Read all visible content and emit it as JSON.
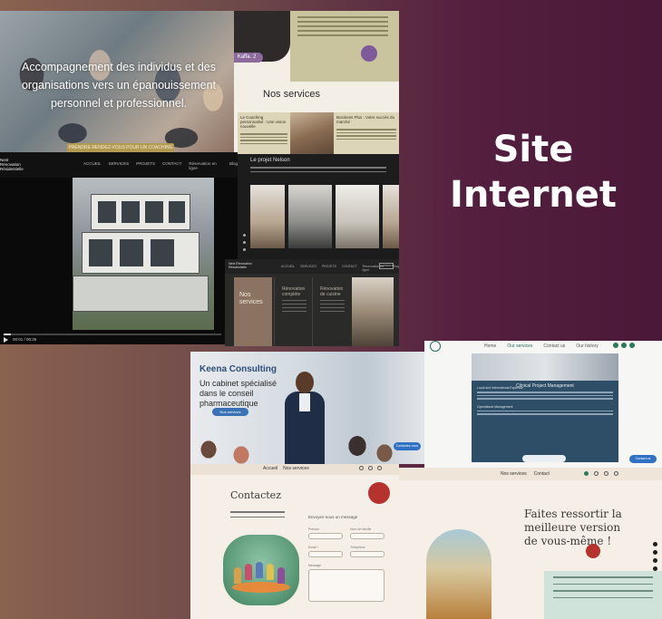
{
  "headline": "Site Internet",
  "hero": {
    "text": "Accompagnement des individus et des organisations vers un épanouissement personnel et professionnel.",
    "button": "PRENDRE RENDEZ-VOUS POUR UN COACHING GRATUIT"
  },
  "services_page": {
    "badge": "Kaffa. 2",
    "title": "Nos services",
    "card_1_title": "Le Coaching personnalisé : Une vision nouvelle",
    "card_2_title": "Business Plus : Votre succès du marché"
  },
  "architecture_site": {
    "logo": "Nest Rénovation Résidentielle",
    "menu": [
      "ACCUEIL",
      "SERVICES",
      "PROJETS",
      "CONTACT",
      "Réservation en ligne",
      "Blog"
    ],
    "time": "00:01 / 00:35"
  },
  "nelson": {
    "title": "Le projet Nelson"
  },
  "dark_services": {
    "logo": "Nest Rénovation Résidentielle",
    "menu": [
      "ACCUEIL",
      "SERVICES",
      "PROJETS",
      "CONTACT",
      "Réservation en ligne",
      "Blog"
    ],
    "nav_button": "CONTACT",
    "tile": "Nos services",
    "col_1": "Rénovation complète",
    "col_2": "Rénovation de cuisine"
  },
  "keena": {
    "brand": "Keena Consulting",
    "tagline": "Un cabinet spécialisé dans le conseil pharmaceutique",
    "cta": "Nos services",
    "chat": "Contactez-nous"
  },
  "clinical": {
    "menu": [
      "Home",
      "Our services",
      "Contact us",
      "Our history"
    ],
    "box_title": "Clinical Project Management",
    "bullet_1": "Local and International Expertise",
    "bullet_2": "Operational Management",
    "chat": "Contact us"
  },
  "contact": {
    "menu": [
      "Accueil",
      "Nos services"
    ],
    "title": "Contactez",
    "form_title": "Envoyez-nous un message",
    "labels": [
      "Prénom",
      "Nom de famille",
      "Email *",
      "Téléphone",
      "Message"
    ]
  },
  "faites": {
    "menu": [
      "Nos services",
      "Contact"
    ],
    "headline": "Faites ressortir la meilleure version de vous-même !"
  },
  "colors": {
    "accent_purple": "#7f5a9a",
    "accent_red": "#b5332c",
    "keena_blue": "#2b4f7a",
    "clinical_navy": "#2e4d66"
  }
}
